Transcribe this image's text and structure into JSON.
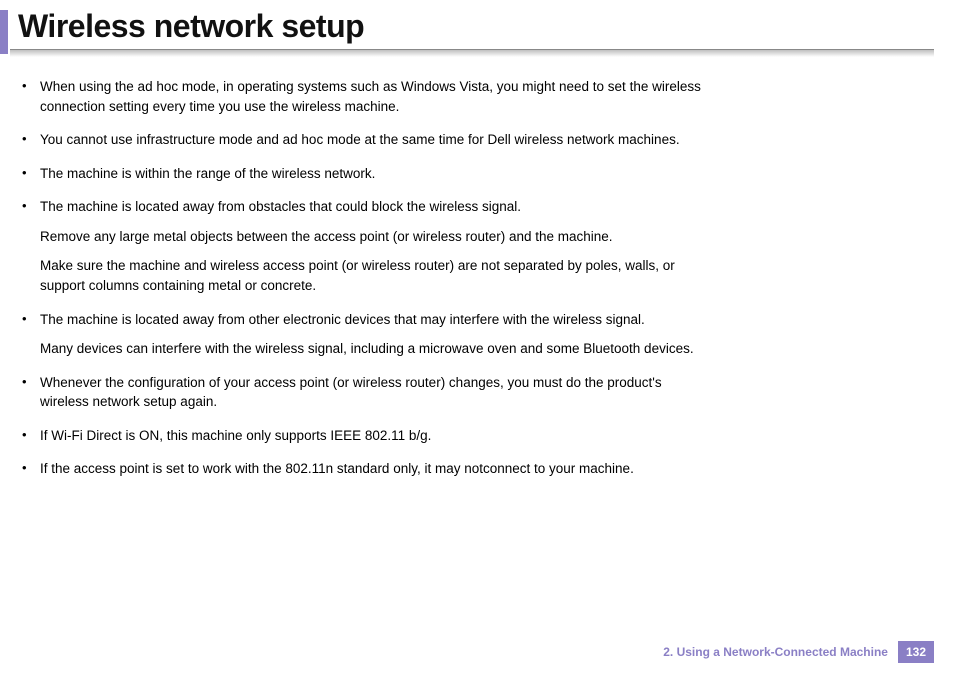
{
  "title": "Wireless network setup",
  "bullets": [
    {
      "text": "When using the ad hoc mode, in operating systems such as Windows Vista, you might need to set the wireless connection setting every time you use the wireless machine.",
      "subs": []
    },
    {
      "text": "You cannot use infrastructure mode and ad hoc mode at the same time for Dell wireless network machines.",
      "subs": []
    },
    {
      "text": "The machine is within the range of the wireless network.",
      "subs": []
    },
    {
      "text": "The machine is located away from obstacles that could block the wireless signal.",
      "subs": [
        "Remove any large metal objects between the access point (or wireless router) and the machine.",
        "Make sure the machine and wireless access point (or wireless router) are not separated by poles, walls, or support columns containing metal or concrete."
      ]
    },
    {
      "text": "The machine is located away from other electronic devices that may interfere with the wireless signal.",
      "subs": [
        "Many devices can interfere with the wireless signal, including a microwave oven and some Bluetooth devices."
      ]
    },
    {
      "text": "Whenever the configuration of your access point (or wireless router) changes, you must do the product's wireless network setup again.",
      "subs": []
    },
    {
      "text": "If Wi-Fi Direct is ON, this machine only supports IEEE 802.11 b/g.",
      "subs": []
    },
    {
      "text": "If the access point is set to work with the 802.11n standard only, it may notconnect to your machine.",
      "subs": []
    }
  ],
  "footer": {
    "chapter": "2.  Using a Network-Connected Machine",
    "page": "132"
  }
}
